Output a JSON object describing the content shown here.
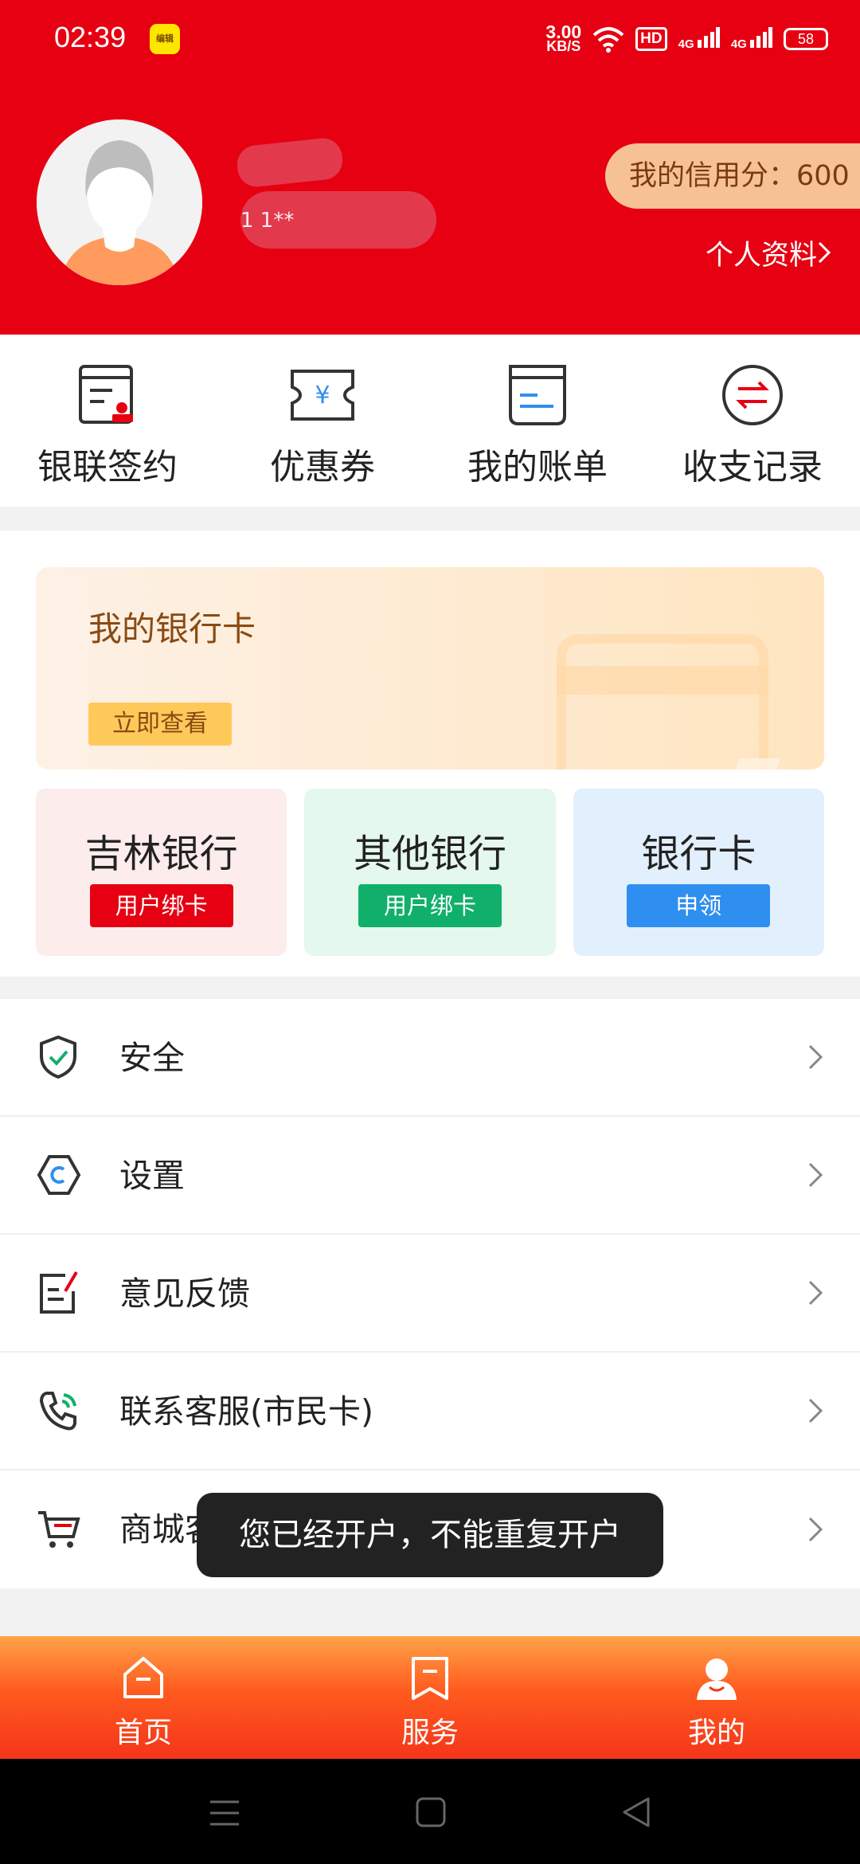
{
  "status_bar": {
    "time": "02:39",
    "app_icon_text": "编辑",
    "speed_value": "3.00",
    "speed_unit": "KB/S",
    "hd": "HD",
    "signal1": "4G",
    "signal2": "4G",
    "battery": "58"
  },
  "profile": {
    "phone_partial": "1 1**",
    "credit_score_label": "我的信用分：600",
    "profile_link": "个人资料"
  },
  "quick_actions": [
    {
      "label": "银联签约",
      "icon": "contract-stamp-icon"
    },
    {
      "label": "优惠券",
      "icon": "coupon-ticket-icon"
    },
    {
      "label": "我的账单",
      "icon": "bill-icon"
    },
    {
      "label": "收支记录",
      "icon": "transfer-arrows-icon"
    }
  ],
  "my_card": {
    "title": "我的银行卡",
    "button": "立即查看"
  },
  "banks": [
    {
      "name": "吉林银行",
      "button": "用户绑卡",
      "color": "#e60012"
    },
    {
      "name": "其他银行",
      "button": "用户绑卡",
      "color": "#10b06a"
    },
    {
      "name": "银行卡",
      "button": "申领",
      "color": "#2f8ff0"
    }
  ],
  "menu": [
    {
      "label": "安全",
      "icon": "shield-check-icon"
    },
    {
      "label": "设置",
      "icon": "hexagon-settings-icon"
    },
    {
      "label": "意见反馈",
      "icon": "feedback-edit-icon"
    },
    {
      "label": "联系客服(市民卡)",
      "icon": "phone-call-icon"
    },
    {
      "label": "商城客",
      "icon": "shopping-cart-icon"
    }
  ],
  "toast": "您已经开户，不能重复开户",
  "bottom_nav": [
    {
      "label": "首页",
      "icon": "home-icon"
    },
    {
      "label": "服务",
      "icon": "service-bookmark-icon"
    },
    {
      "label": "我的",
      "icon": "user-icon"
    }
  ],
  "colors": {
    "brand_red": "#e60012",
    "nav_gradient_top": "#ffa347",
    "nav_gradient_bottom": "#f4351a"
  }
}
